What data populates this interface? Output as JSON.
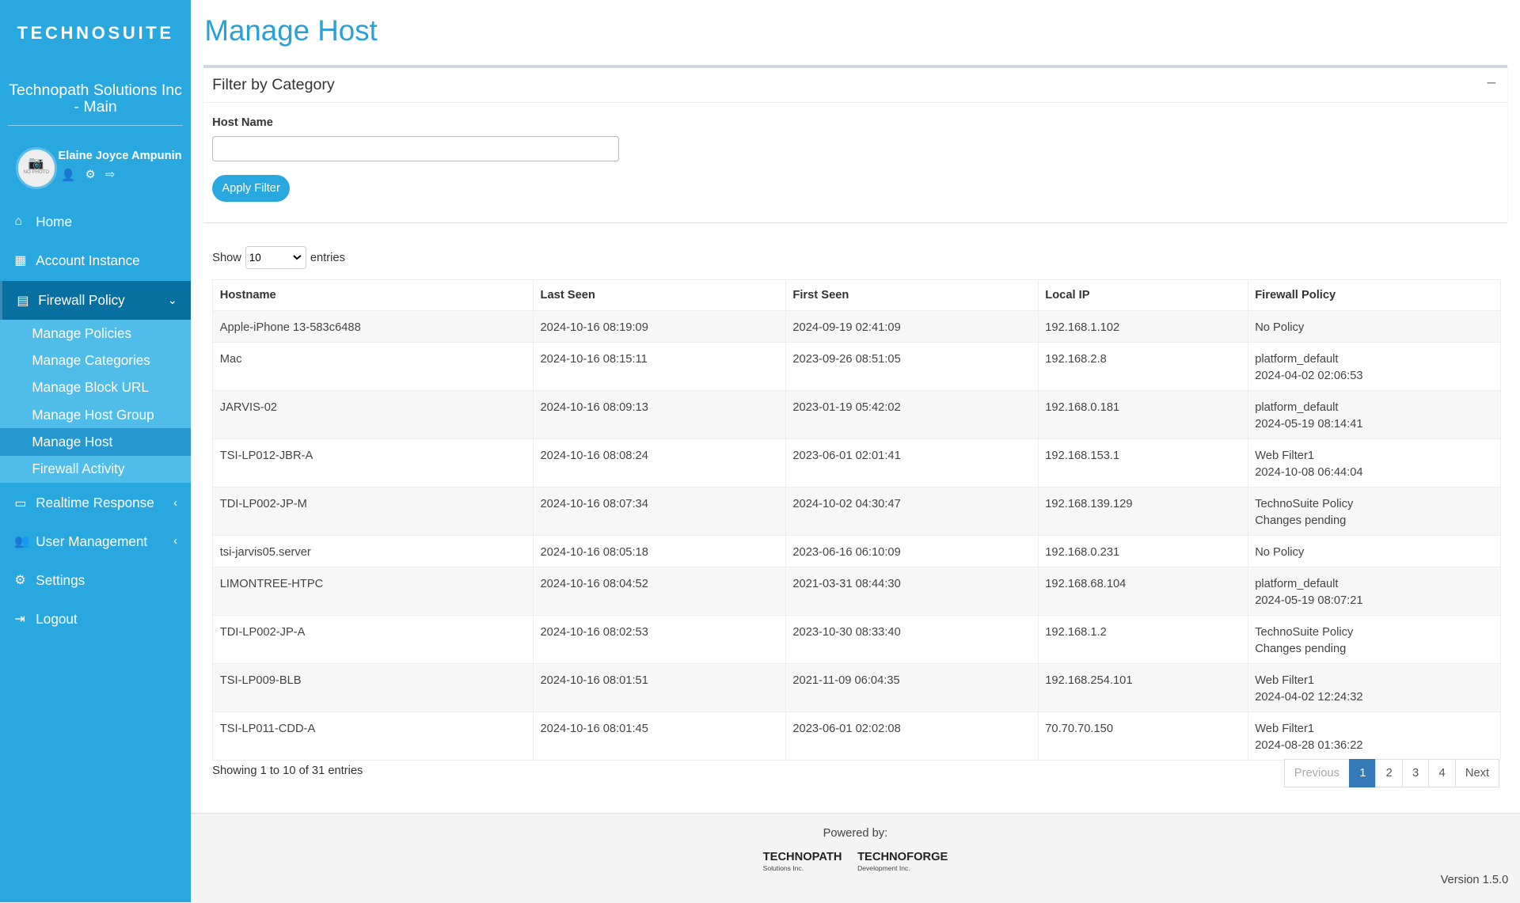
{
  "sidebar": {
    "logo": "TECHNOSUITE",
    "org": "Technopath Solutions Inc - Main",
    "avatar_text": "NO PHOTO",
    "user": "Elaine Joyce Ampunin",
    "nav": [
      {
        "label": "Home"
      },
      {
        "label": "Account Instance"
      },
      {
        "label": "Firewall Policy"
      },
      {
        "label": "Realtime Response"
      },
      {
        "label": "User Management"
      },
      {
        "label": "Settings"
      },
      {
        "label": "Logout"
      }
    ],
    "sub": [
      "Manage Policies",
      "Manage Categories",
      "Manage Block URL",
      "Manage Host Group",
      "Manage Host",
      "Firewall Activity"
    ]
  },
  "page": {
    "title": "Manage Host"
  },
  "filter": {
    "title": "Filter by Category",
    "host_label": "Host Name",
    "host_value": "",
    "apply": "Apply Filter"
  },
  "table": {
    "show": "Show",
    "entries": "entries",
    "page_size": "10",
    "headers": [
      "Hostname",
      "Last Seen",
      "First Seen",
      "Local IP",
      "Firewall Policy"
    ],
    "rows": [
      [
        "Apple-iPhone 13-583c6488",
        "2024-10-16 08:19:09",
        "2024-09-19 02:41:09",
        "192.168.1.102",
        "No Policy",
        ""
      ],
      [
        "Mac",
        "2024-10-16 08:15:11",
        "2023-09-26 08:51:05",
        "192.168.2.8",
        "platform_default",
        "2024-04-02 02:06:53"
      ],
      [
        "JARVIS-02",
        "2024-10-16 08:09:13",
        "2023-01-19 05:42:02",
        "192.168.0.181",
        "platform_default",
        "2024-05-19 08:14:41"
      ],
      [
        "TSI-LP012-JBR-A",
        "2024-10-16 08:08:24",
        "2023-06-01 02:01:41",
        "192.168.153.1",
        "Web Filter1",
        "2024-10-08 06:44:04"
      ],
      [
        "TDI-LP002-JP-M",
        "2024-10-16 08:07:34",
        "2024-10-02 04:30:47",
        "192.168.139.129",
        "TechnoSuite Policy",
        "Changes pending"
      ],
      [
        "tsi-jarvis05.server",
        "2024-10-16 08:05:18",
        "2023-06-16 06:10:09",
        "192.168.0.231",
        "No Policy",
        ""
      ],
      [
        "LIMONTREE-HTPC",
        "2024-10-16 08:04:52",
        "2021-03-31 08:44:30",
        "192.168.68.104",
        "platform_default",
        "2024-05-19 08:07:21"
      ],
      [
        "TDI-LP002-JP-A",
        "2024-10-16 08:02:53",
        "2023-10-30 08:33:40",
        "192.168.1.2",
        "TechnoSuite Policy",
        "Changes pending"
      ],
      [
        "TSI-LP009-BLB",
        "2024-10-16 08:01:51",
        "2021-11-09 06:04:35",
        "192.168.254.101",
        "Web Filter1",
        "2024-04-02 12:24:32"
      ],
      [
        "TSI-LP011-CDD-A",
        "2024-10-16 08:01:45",
        "2023-06-01 02:02:08",
        "70.70.70.150",
        "Web Filter1",
        "2024-08-28 01:36:22"
      ]
    ],
    "info": "Showing 1 to 10 of 31 entries",
    "pagination": [
      "Previous",
      "1",
      "2",
      "3",
      "4",
      "Next"
    ]
  },
  "footer": {
    "powered": "Powered by:",
    "logo1": "TECHNOPATH",
    "logo1_sub": "Solutions Inc.",
    "logo2": "TECHNOFORGE",
    "logo2_sub": "Development Inc.",
    "version": "Version 1.5.0"
  }
}
